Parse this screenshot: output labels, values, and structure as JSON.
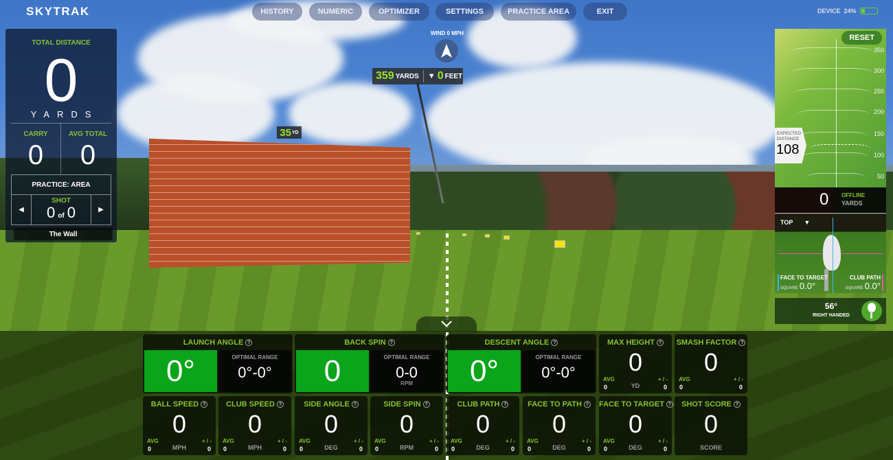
{
  "app": {
    "logo": "SKYTRAK"
  },
  "nav": {
    "items": [
      {
        "label": "HISTORY"
      },
      {
        "label": "NUMERIC"
      },
      {
        "label": "OPTIMIZER"
      },
      {
        "label": "SETTINGS"
      },
      {
        "label": "PRACTICE AREA"
      },
      {
        "label": "EXIT"
      }
    ],
    "device_label": "DEVICE",
    "battery_percent_text": "24%",
    "battery_level": 0.24
  },
  "left_panel": {
    "total_distance_label": "TOTAL DISTANCE",
    "total_distance": "0",
    "total_unit": "YARDS",
    "carry_label": "CARRY",
    "carry": "0",
    "avg_total_label": "AVG TOTAL",
    "avg_total": "0",
    "mode": "PRACTICE: AREA",
    "shot_label": "SHOT",
    "shot_current": "0",
    "shot_of": "of",
    "shot_total": "0",
    "prev_icon": "triangle-left-icon",
    "next_icon": "triangle-right-icon",
    "course_name": "The Wall"
  },
  "scene": {
    "wind_label": "WIND 0 MPH",
    "wind_icon": "wind-direction-arrow-icon",
    "carry_distance": "359",
    "carry_unit": "YARDS",
    "height_icon": "triangle-down-icon",
    "height": "0",
    "height_unit": "FEET",
    "wall_marker": "35",
    "wall_marker_unit": "YD",
    "toggle_icon": "chevron-down-icon"
  },
  "right_panel": {
    "reset_label": "RESET",
    "distance_ticks": [
      "350",
      "300",
      "250",
      "200",
      "150",
      "100",
      "50"
    ],
    "expected_label_1": "EXPECTED",
    "expected_label_2": "DISTANCE",
    "expected_distance": "108",
    "offline_value": "0",
    "offline_label": "OFFLINE",
    "offline_unit": "YARDS",
    "view_label": "TOP",
    "view_icon": "triangle-down-icon",
    "face_to_target_label": "FACE TO TARGET",
    "face_to_target_sub": "SQUARE",
    "face_to_target_value": "0.0°",
    "club_path_label": "CLUB PATH",
    "club_path_sub": "SQUARE",
    "club_path_value": "0.0°",
    "club_loft": "56°",
    "handedness": "RIGHT HANDED",
    "club_icon": "wedge-club-icon"
  },
  "metrics": {
    "optimizer": [
      {
        "label": "LAUNCH ANGLE",
        "value": "0°",
        "range_label": "OPTIMAL RANGE",
        "range": "0°-0°",
        "range_unit": ""
      },
      {
        "label": "BACK SPIN",
        "value": "0",
        "range_label": "OPTIMAL RANGE",
        "range": "0-0",
        "range_unit": "RPM"
      },
      {
        "label": "DESCENT ANGLE",
        "value": "0°",
        "range_label": "OPTIMAL RANGE",
        "range": "0°-0°",
        "range_unit": ""
      }
    ],
    "row1": [
      {
        "label": "MAX HEIGHT",
        "value": "0",
        "avg_label": "AVG",
        "avg": "0",
        "unit": "YD",
        "pm_label": "+ / -",
        "pm": "0"
      },
      {
        "label": "SMASH FACTOR",
        "value": "0",
        "avg_label": "AVG",
        "avg": "0",
        "unit": "",
        "pm_label": "+ / -",
        "pm": "0"
      }
    ],
    "row2": [
      {
        "label": "BALL SPEED",
        "value": "0",
        "avg_label": "AVG",
        "avg": "0",
        "unit": "MPH",
        "pm_label": "+ / -",
        "pm": "0"
      },
      {
        "label": "CLUB SPEED",
        "value": "0",
        "avg_label": "AVG",
        "avg": "0",
        "unit": "MPH",
        "pm_label": "+ / -",
        "pm": "0"
      },
      {
        "label": "SIDE ANGLE",
        "value": "0",
        "avg_label": "AVG",
        "avg": "0",
        "unit": "DEG",
        "pm_label": "+ / -",
        "pm": "0"
      },
      {
        "label": "SIDE SPIN",
        "value": "0",
        "avg_label": "AVG",
        "avg": "0",
        "unit": "RPM",
        "pm_label": "+ / -",
        "pm": "0"
      },
      {
        "label": "CLUB PATH",
        "value": "0",
        "avg_label": "AVG",
        "avg": "0",
        "unit": "DEG",
        "pm_label": "+ / -",
        "pm": "0"
      },
      {
        "label": "FACE TO PATH",
        "value": "0",
        "avg_label": "AVG",
        "avg": "0",
        "unit": "DEG",
        "pm_label": "+ / -",
        "pm": "0"
      },
      {
        "label": "FACE TO TARGET",
        "value": "0",
        "avg_label": "AVG",
        "avg": "0",
        "unit": "DEG",
        "pm_label": "+ / -",
        "pm": "0"
      },
      {
        "label": "SHOT SCORE",
        "value": "0",
        "unit": "SCORE"
      }
    ],
    "help_icon": "question-circle-icon"
  },
  "colors": {
    "accent_green": "#86c232",
    "value_green": "#0aa51a",
    "carry_green": "#9be22d",
    "face_blue": "#3fb8e6",
    "path_pink": "#e75ca6"
  }
}
